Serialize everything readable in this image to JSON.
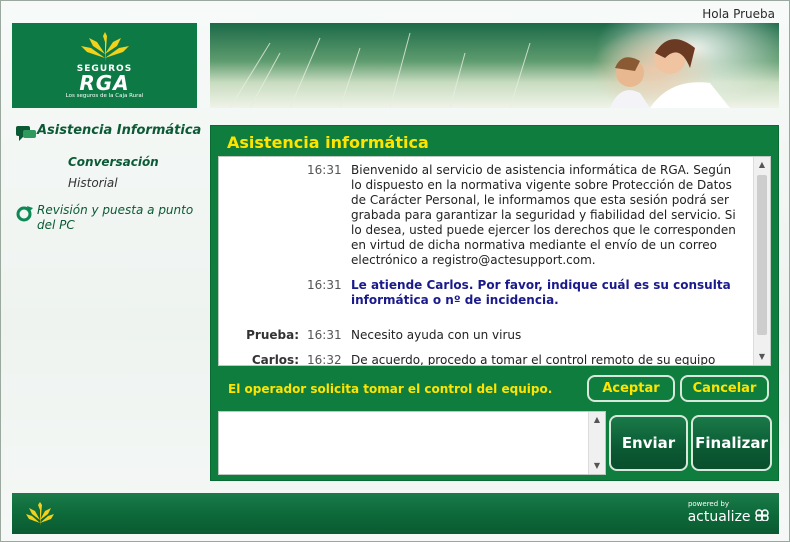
{
  "header": {
    "greeting": "Hola Prueba",
    "logo": {
      "sub": "SEGUROS",
      "main": "RGA",
      "tagline": "Los seguros de la Caja Rural"
    }
  },
  "sidebar": {
    "section_label": "Asistencia Informática",
    "sub_items": [
      {
        "label": "Conversación",
        "active": true
      },
      {
        "label": "Historial",
        "active": false
      }
    ],
    "second_label": "Revisión y puesta a punto del PC"
  },
  "panel": {
    "title": "Asistencia informática",
    "messages": [
      {
        "who": "",
        "time": "16:31",
        "text": "Bienvenido al servicio de asistencia informática de RGA. Según lo dispuesto en la normativa vigente sobre Protección de Datos de Carácter Personal, le informamos que esta sesión podrá ser grabada para garantizar la seguridad y fiabilidad del servicio. Si lo desea, usted puede ejercer los derechos que le corresponden en virtud de dicha normativa mediante el envío de un correo electrónico a registro@actesupport.com.",
        "bold": false
      },
      {
        "who": "",
        "time": "16:31",
        "text": "Le atiende Carlos. Por favor, indique cuál es su consulta informática o nº de incidencia.",
        "bold": true
      },
      {
        "who": "Prueba:",
        "time": "16:31",
        "text": "Necesito ayuda con un virus",
        "bold": false
      },
      {
        "who": "Carlos:",
        "time": "16:32",
        "text": "De acuerdo, procedo a tomar el control remoto de su equipo",
        "bold": false
      }
    ],
    "notice": "El operador solicita tomar el control del equipo.",
    "accept_label": "Aceptar",
    "cancel_label": "Cancelar",
    "input_value": "",
    "send_label": "Enviar",
    "end_label": "Finalizar"
  },
  "footer": {
    "powered": "powered by",
    "brand": "actualize"
  },
  "colors": {
    "brand_green": "#0f7d3e",
    "accent_yellow": "#ffe400",
    "message_blue": "#1a1a8c"
  }
}
